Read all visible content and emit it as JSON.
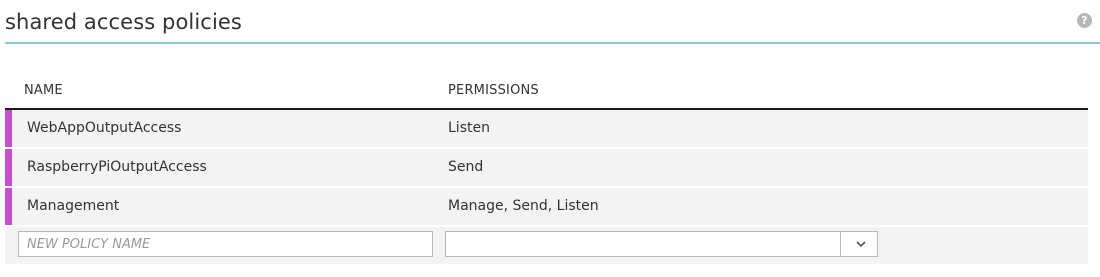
{
  "header": {
    "title": "shared access policies",
    "help_icon": "help-icon",
    "help_glyph": "?"
  },
  "table": {
    "columns": {
      "name": "NAME",
      "permissions": "PERMISSIONS"
    },
    "rows": [
      {
        "name": "WebAppOutputAccess",
        "permissions": "Listen"
      },
      {
        "name": "RaspberryPiOutputAccess",
        "permissions": "Send"
      },
      {
        "name": "Management",
        "permissions": "Manage, Send, Listen"
      }
    ],
    "row_marker_color": "#c651cf",
    "new_policy": {
      "name_value": "",
      "name_placeholder": "NEW POLICY NAME",
      "permissions_value": "",
      "select_icon": "chevron-down-icon"
    }
  },
  "colors": {
    "header_rule": "#8cc2e2",
    "row_background": "#f3f3f3",
    "text": "#333333"
  }
}
